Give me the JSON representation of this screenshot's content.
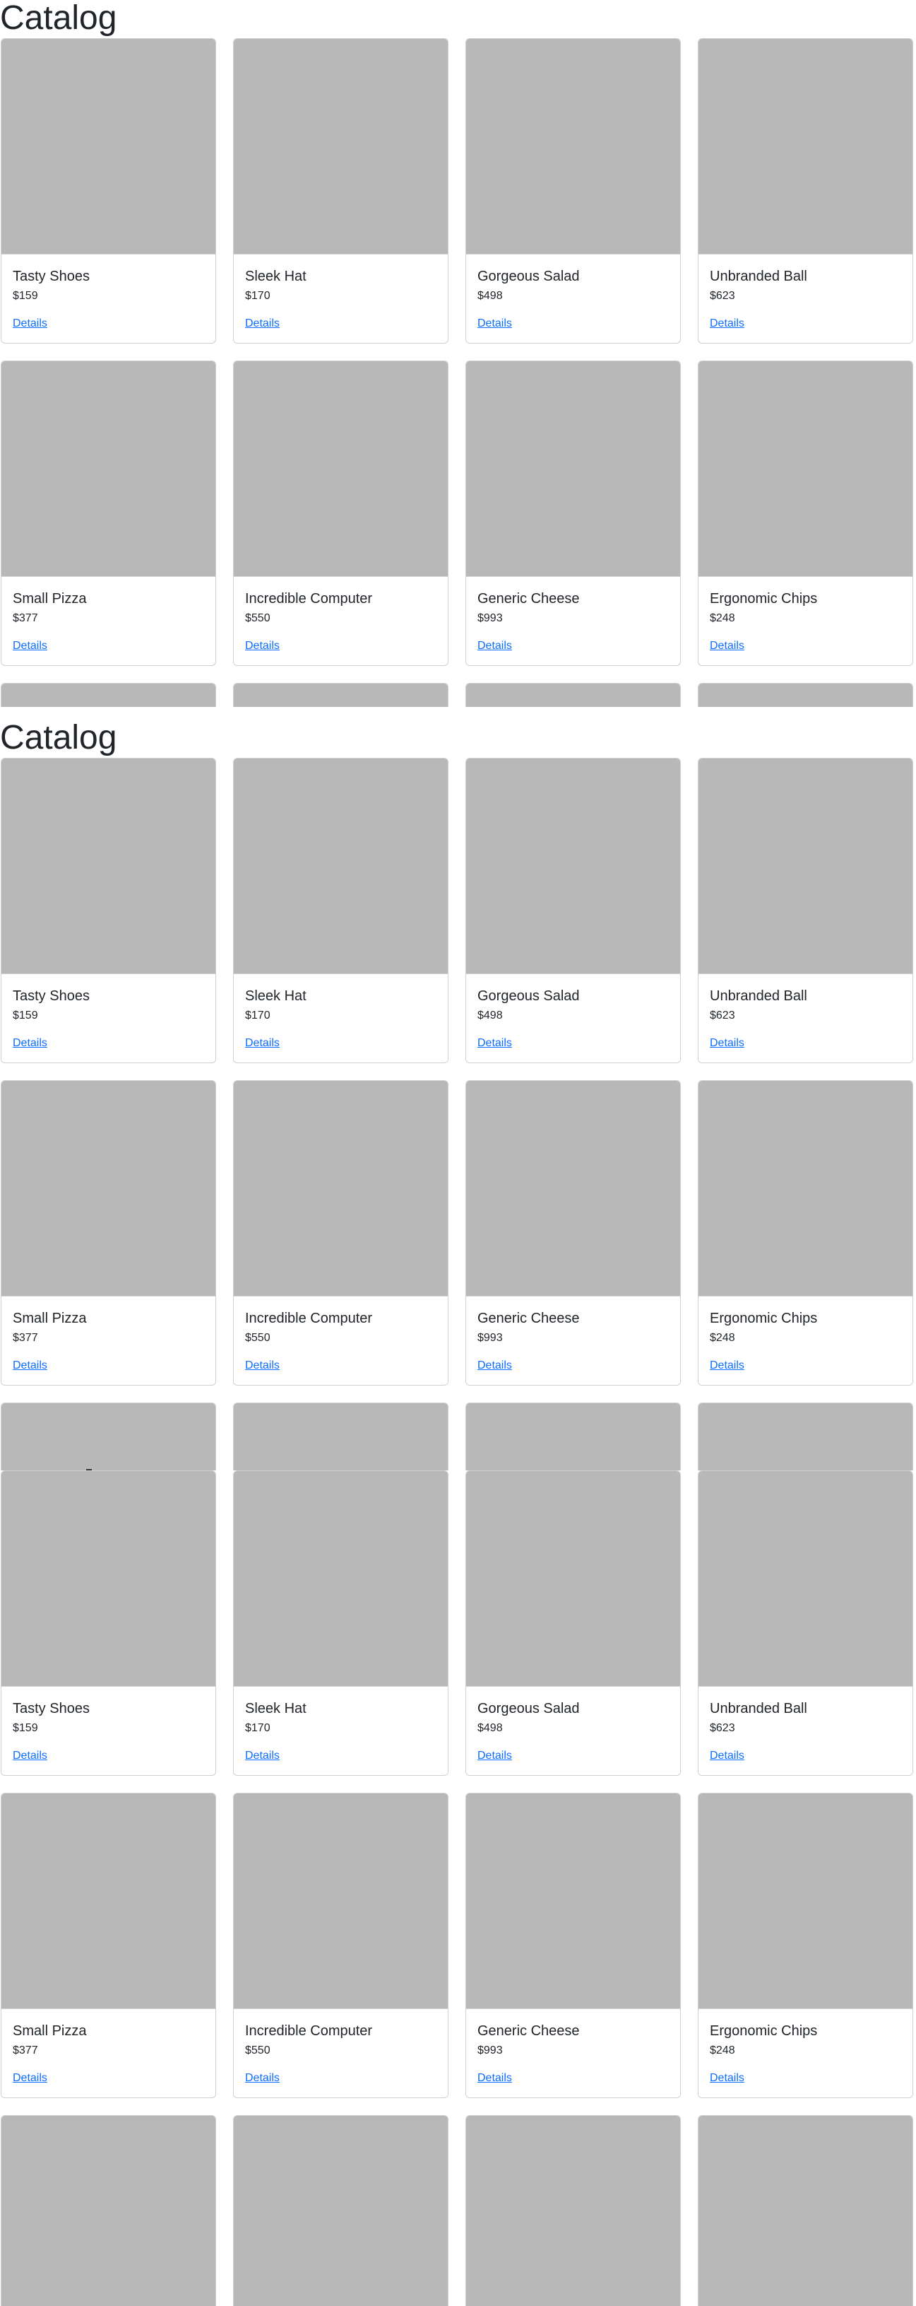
{
  "catalog": {
    "title": "Catalog",
    "details_label": "Details",
    "products": [
      {
        "name": "Tasty Shoes",
        "price": "$159"
      },
      {
        "name": "Sleek Hat",
        "price": "$170"
      },
      {
        "name": "Gorgeous Salad",
        "price": "$498"
      },
      {
        "name": "Unbranded Ball",
        "price": "$623"
      },
      {
        "name": "Small Pizza",
        "price": "$377"
      },
      {
        "name": "Incredible Computer",
        "price": "$550"
      },
      {
        "name": "Generic Cheese",
        "price": "$993"
      },
      {
        "name": "Ergonomic Chips",
        "price": "$248"
      }
    ]
  },
  "colors": {
    "image_placeholder": "#b8b8b8",
    "link": "#0d6efd",
    "card_border": "#d0d0d0",
    "text": "#212529"
  }
}
